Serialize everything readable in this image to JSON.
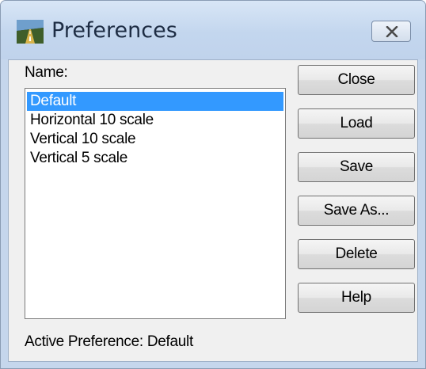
{
  "window": {
    "title": "Preferences",
    "close_icon": "close-x-icon",
    "app_icon": "road-preferences-icon"
  },
  "list": {
    "label": "Name:",
    "items": [
      {
        "label": "Default",
        "selected": true
      },
      {
        "label": "Horizontal 10 scale",
        "selected": false
      },
      {
        "label": "Vertical 10 scale",
        "selected": false
      },
      {
        "label": "Vertical 5 scale",
        "selected": false
      }
    ]
  },
  "buttons": {
    "close": "Close",
    "load": "Load",
    "save": "Save",
    "save_as": "Save As...",
    "delete": "Delete",
    "help": "Help"
  },
  "status": {
    "text": "Active Preference: Default"
  },
  "colors": {
    "selection": "#3399ff",
    "frame": "#c5d6ec",
    "client": "#f0f0f0"
  }
}
